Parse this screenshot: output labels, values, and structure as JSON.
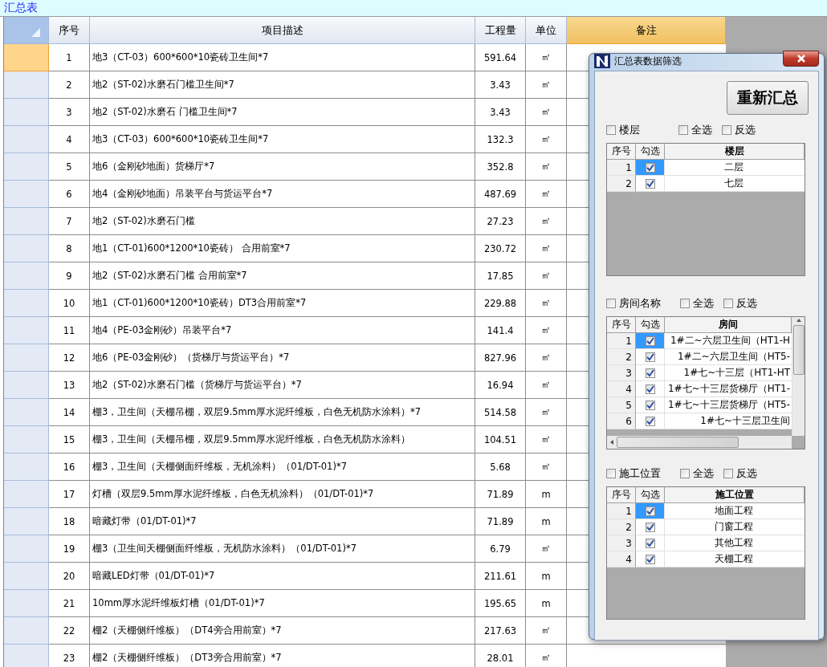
{
  "sheet": {
    "title": "汇总表"
  },
  "table": {
    "columns": [
      {
        "label": "序号",
        "selected": false
      },
      {
        "label": "项目描述",
        "selected": false
      },
      {
        "label": "工程量",
        "selected": false
      },
      {
        "label": "单位",
        "selected": false
      },
      {
        "label": "备注",
        "selected": true
      }
    ],
    "rows": [
      {
        "selected": true,
        "cells": [
          "1",
          "地3（CT-03）600*600*10瓷砖卫生间*7",
          "591.64",
          "㎡"
        ]
      },
      {
        "selected": false,
        "cells": [
          "2",
          "地2（ST-02)水磨石门槛卫生间*7",
          "3.43",
          "㎡"
        ]
      },
      {
        "selected": false,
        "cells": [
          "3",
          "地2（ST-02)水磨石 门槛卫生间*7",
          "3.43",
          "㎡"
        ]
      },
      {
        "selected": false,
        "cells": [
          "4",
          "地3（CT-03）600*600*10瓷砖卫生间*7",
          "132.3",
          "㎡"
        ]
      },
      {
        "selected": false,
        "cells": [
          "5",
          "地6（金刚砂地面）货梯厅*7",
          "352.8",
          "㎡"
        ]
      },
      {
        "selected": false,
        "cells": [
          "6",
          "地4（金刚砂地面）吊装平台与货运平台*7",
          "487.69",
          "㎡"
        ]
      },
      {
        "selected": false,
        "cells": [
          "7",
          "地2（ST-02)水磨石门槛",
          "27.23",
          "㎡"
        ]
      },
      {
        "selected": false,
        "cells": [
          "8",
          "地1（CT-01)600*1200*10瓷砖） 合用前室*7",
          "230.72",
          "㎡"
        ]
      },
      {
        "selected": false,
        "cells": [
          "9",
          "地2（ST-02)水磨石门槛 合用前室*7",
          "17.85",
          "㎡"
        ]
      },
      {
        "selected": false,
        "cells": [
          "10",
          "地1（CT-01)600*1200*10瓷砖）DT3合用前室*7",
          "229.88",
          "㎡"
        ]
      },
      {
        "selected": false,
        "cells": [
          "11",
          "地4（PE-03金刚砂）吊装平台*7",
          "141.4",
          "㎡"
        ]
      },
      {
        "selected": false,
        "cells": [
          "12",
          "地6（PE-03金刚砂）（货梯厅与货运平台）*7",
          "827.96",
          "㎡"
        ]
      },
      {
        "selected": false,
        "cells": [
          "13",
          "地2（ST-02)水磨石门槛（货梯厅与货运平台）*7",
          "16.94",
          "㎡"
        ]
      },
      {
        "selected": false,
        "cells": [
          "14",
          "棚3，卫生间（天棚吊棚，双层9.5mm厚水泥纤维板，白色无机防水涂料）*7",
          "514.58",
          "㎡"
        ]
      },
      {
        "selected": false,
        "cells": [
          "15",
          "棚3，卫生间（天棚吊棚，双层9.5mm厚水泥纤维板，白色无机防水涂料）",
          "104.51",
          "㎡"
        ]
      },
      {
        "selected": false,
        "cells": [
          "16",
          "棚3，卫生间（天棚侧面纤维板，无机涂料）（01/DT-01)*7",
          "5.68",
          "㎡"
        ]
      },
      {
        "selected": false,
        "cells": [
          "17",
          "灯槽（双层9.5mm厚水泥纤维板，白色无机涂料）（01/DT-01)*7",
          "71.89",
          "m"
        ]
      },
      {
        "selected": false,
        "cells": [
          "18",
          "暗藏灯带（01/DT-01)*7",
          "71.89",
          "m"
        ]
      },
      {
        "selected": false,
        "cells": [
          "19",
          "棚3（卫生间天棚侧面纤维板，无机防水涂料）（01/DT-01)*7",
          "6.79",
          "㎡"
        ]
      },
      {
        "selected": false,
        "cells": [
          "20",
          "暗藏LED灯带（01/DT-01)*7",
          "211.61",
          "m"
        ]
      },
      {
        "selected": false,
        "cells": [
          "21",
          "10mm厚水泥纤维板灯槽（01/DT-01)*7",
          "195.65",
          "m"
        ]
      },
      {
        "selected": false,
        "cells": [
          "22",
          "棚2（天棚侧纤维板）（DT4旁合用前室）*7",
          "217.63",
          "㎡"
        ]
      },
      {
        "selected": false,
        "cells": [
          "23",
          "棚2（天棚侧纤维板）（DT3旁合用前室）*7",
          "28.01",
          "㎡"
        ]
      }
    ]
  },
  "dialog": {
    "title": "汇总表数据筛选",
    "button": "重新汇总",
    "sections": [
      {
        "kind": "plain",
        "label": "楼层",
        "checked": false,
        "select_all": {
          "label": "全选",
          "checked": false
        },
        "invert": {
          "label": "反选",
          "checked": false
        },
        "columns": [
          "序号",
          "勾选",
          "楼层"
        ],
        "rows": [
          {
            "index": "1",
            "checked": true,
            "selected": true,
            "value": "二层"
          },
          {
            "index": "2",
            "checked": true,
            "selected": false,
            "value": "七层"
          }
        ]
      },
      {
        "kind": "scroll",
        "label": "房间名称",
        "checked": false,
        "select_all": {
          "label": "全选",
          "checked": false
        },
        "invert": {
          "label": "反选",
          "checked": false
        },
        "columns": [
          "序号",
          "勾选",
          "房间"
        ],
        "rows": [
          {
            "index": "1",
            "checked": true,
            "selected": true,
            "value": "1#二~六层卫生间（HT1-H"
          },
          {
            "index": "2",
            "checked": true,
            "selected": false,
            "value": "1#二~六层卫生间（HT5-"
          },
          {
            "index": "3",
            "checked": true,
            "selected": false,
            "value": "1#七~十三层（HT1-HT"
          },
          {
            "index": "4",
            "checked": true,
            "selected": false,
            "value": "1#七~十三层货梯厅（HT1-"
          },
          {
            "index": "5",
            "checked": true,
            "selected": false,
            "value": "1#七~十三层货梯厅（HT5-"
          },
          {
            "index": "6",
            "checked": true,
            "selected": false,
            "value": "1#七~十三层卫生间"
          }
        ]
      },
      {
        "kind": "plain",
        "label": "施工位置",
        "checked": false,
        "select_all": {
          "label": "全选",
          "checked": false
        },
        "invert": {
          "label": "反选",
          "checked": false
        },
        "columns": [
          "序号",
          "勾选",
          "施工位置"
        ],
        "rows": [
          {
            "index": "1",
            "checked": true,
            "selected": true,
            "value": "地面工程"
          },
          {
            "index": "2",
            "checked": true,
            "selected": false,
            "value": "门窗工程"
          },
          {
            "index": "3",
            "checked": true,
            "selected": false,
            "value": "其他工程"
          },
          {
            "index": "4",
            "checked": true,
            "selected": false,
            "value": "天棚工程"
          }
        ]
      }
    ]
  }
}
